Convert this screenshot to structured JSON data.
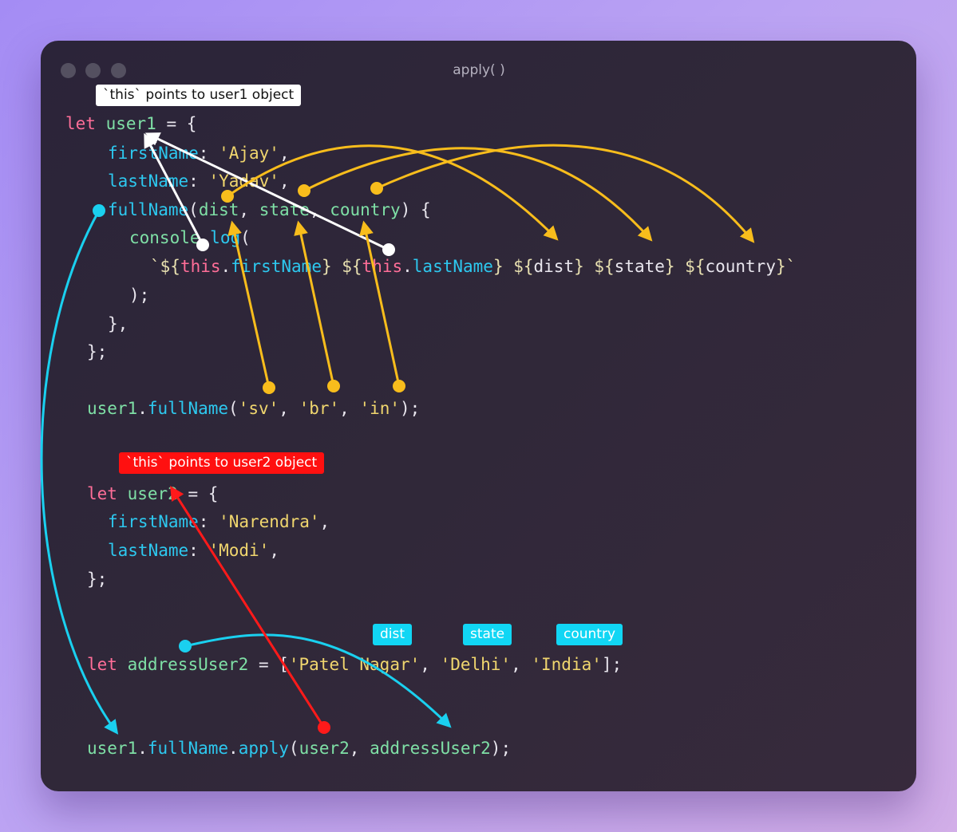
{
  "window": {
    "title": "apply( )",
    "dot_color": "#545060"
  },
  "labels": {
    "this_user1": "`this` points to user1 object",
    "this_user2": "`this` points to user2 object",
    "dist": "dist",
    "state": "state",
    "country": "country"
  },
  "code": {
    "kw_let": "let",
    "user1": "user1",
    "user2": "user2",
    "eq_brace": " = {",
    "firstName": "firstName",
    "lastName": "lastName",
    "colon": ": ",
    "comma": ",",
    "ajay": "'Ajay'",
    "yadav": "'Yadav'",
    "fullName": "fullName",
    "paren_open": "(",
    "dist": "dist",
    "state": "state",
    "country": "country",
    "sep": ", ",
    "params_close": ") {",
    "console": "console",
    "dot": ".",
    "log": "log",
    "tpl_open": "`${",
    "this": "this",
    "tpl_mid": "} ${",
    "tpl_end": "}`",
    "close_paren_semi": ");",
    "close_brace_comma": "},",
    "close_brace_semi": "};",
    "call_close": ");",
    "sv": "'sv'",
    "br": "'br'",
    "in": "'in'",
    "narendra": "'Narendra'",
    "modi": "'Modi'",
    "addressUser2": "addressUser2",
    "eq_bracket": " = [",
    "patel_nagar": "'Patel Nagar'",
    "delhi": "'Delhi'",
    "india": "'India'",
    "bracket_close": "];",
    "apply": "apply"
  },
  "colors": {
    "keyword": "#ff6e98",
    "variable": "#7fe0a6",
    "property": "#2dc8ef",
    "string": "#f0d66e",
    "arrow_white": "#ffffff",
    "arrow_yellow": "#f8bd1c",
    "arrow_cyan": "#1ad0ef",
    "arrow_red": "#ff1a1a"
  }
}
